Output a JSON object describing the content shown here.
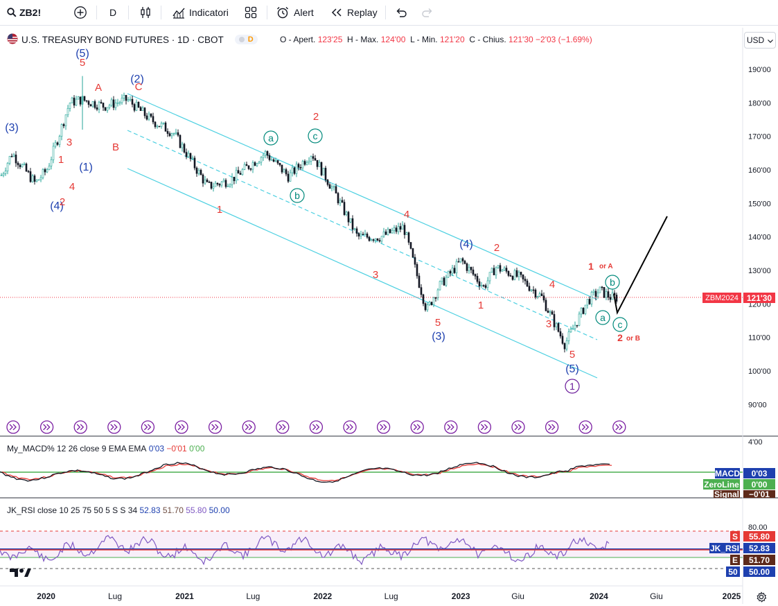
{
  "toolbar": {
    "symbol": "ZB2!",
    "interval": "D",
    "indicators_label": "Indicatori",
    "alert_label": "Alert",
    "replay_label": "Replay"
  },
  "header": {
    "title": "U.S. TREASURY BOND FUTURES · 1D · CBOT",
    "badge": "D",
    "ohlc": {
      "o_label": "O - Apert.",
      "o_value": "123'25",
      "h_label": "H - Max.",
      "h_value": "124'00",
      "l_label": "L - Min.",
      "l_value": "121'20",
      "c_label": "C - Chius.",
      "c_value": "121'30",
      "change": "−2'03 (−1.69%)"
    },
    "currency": "USD"
  },
  "price_axis": {
    "ticks": [
      "190'00",
      "180'00",
      "170'00",
      "160'00",
      "150'00",
      "140'00",
      "130'00",
      "120'00",
      "110'00",
      "100'00",
      "90'00"
    ],
    "current_symbol": "ZBM2024",
    "current_value": "121'30"
  },
  "time_axis": {
    "ticks": [
      "2020",
      "Lug",
      "2021",
      "Lug",
      "2022",
      "Lug",
      "2023",
      "Giu",
      "2024",
      "Giu",
      "2025"
    ]
  },
  "macd": {
    "legend": "My_MACD% 12 26 close 9 EMA EMA",
    "v1": "0'03",
    "v2": "−0'01",
    "v3": "0'00",
    "axis_top": "4'00",
    "labels": [
      {
        "name": "MACD",
        "value": "0'03"
      },
      {
        "name": "ZeroLine",
        "value": "0'00"
      },
      {
        "name": "Signal",
        "value": "−0'01"
      }
    ]
  },
  "rsi": {
    "legend": "JK_RSI close 10 25 75 50 5 S S 34",
    "v1": "52.83",
    "v2": "51.70",
    "v3": "55.80",
    "v4": "50.00",
    "axis_top": "80.00",
    "labels": [
      {
        "name": "S",
        "value": "55.80"
      },
      {
        "name": "JK_RSI",
        "value": "52.83"
      },
      {
        "name": "E",
        "value": "51.70"
      },
      {
        "name": "50",
        "value": "50.00"
      }
    ]
  },
  "waves": {
    "w5p": "(5)",
    "w5": "5",
    "wA": "A",
    "wB": "B",
    "w2p": "(2)",
    "wC": "C",
    "w3p": "(3)",
    "w3": "3",
    "w1": "1",
    "w1p": "(1)",
    "w4": "4",
    "w4p": "(4)",
    "w2": "2",
    "ca": "a",
    "cb": "b",
    "cc": "c",
    "c1": "1",
    "or_a": "or A",
    "or_b": "or B"
  },
  "colors": {
    "up": "#26a69a",
    "down": "#131722",
    "channel": "#4dd0e1",
    "wave_red": "#e53935",
    "wave_blue": "#1e40af",
    "circle": "#00897b"
  },
  "chart_data": {
    "type": "candlestick",
    "title": "U.S. TREASURY BOND FUTURES · 1D · CBOT",
    "x_range": [
      "2019-09",
      "2025-01"
    ],
    "y_range": [
      86,
      196
    ],
    "approx_close_path": [
      {
        "date": "2019-09",
        "close": 158
      },
      {
        "date": "2019-10",
        "close": 165
      },
      {
        "date": "2019-12",
        "close": 156
      },
      {
        "date": "2020-01",
        "close": 160
      },
      {
        "date": "2020-02",
        "close": 170
      },
      {
        "date": "2020-03",
        "close": 180
      },
      {
        "date": "2020-04",
        "close": 181
      },
      {
        "date": "2020-06",
        "close": 179
      },
      {
        "date": "2020-08",
        "close": 181
      },
      {
        "date": "2020-10",
        "close": 175
      },
      {
        "date": "2020-12",
        "close": 171
      },
      {
        "date": "2021-03",
        "close": 155
      },
      {
        "date": "2021-05",
        "close": 157
      },
      {
        "date": "2021-08",
        "close": 165
      },
      {
        "date": "2021-10",
        "close": 158
      },
      {
        "date": "2021-12",
        "close": 165
      },
      {
        "date": "2022-02",
        "close": 153
      },
      {
        "date": "2022-04",
        "close": 140
      },
      {
        "date": "2022-06",
        "close": 140
      },
      {
        "date": "2022-08",
        "close": 143
      },
      {
        "date": "2022-10",
        "close": 118
      },
      {
        "date": "2022-11",
        "close": 125
      },
      {
        "date": "2023-01",
        "close": 133
      },
      {
        "date": "2023-03",
        "close": 125
      },
      {
        "date": "2023-04",
        "close": 131
      },
      {
        "date": "2023-06",
        "close": 128
      },
      {
        "date": "2023-08",
        "close": 122
      },
      {
        "date": "2023-10",
        "close": 108
      },
      {
        "date": "2023-12",
        "close": 121
      },
      {
        "date": "2024-01",
        "close": 124
      },
      {
        "date": "2024-02",
        "close": 121.9
      }
    ],
    "projection": [
      {
        "date": "2024-02",
        "close": 123
      },
      {
        "date": "2024-03",
        "close": 117
      },
      {
        "date": "2024-09",
        "close": 146
      }
    ],
    "last_close": 121.94
  }
}
